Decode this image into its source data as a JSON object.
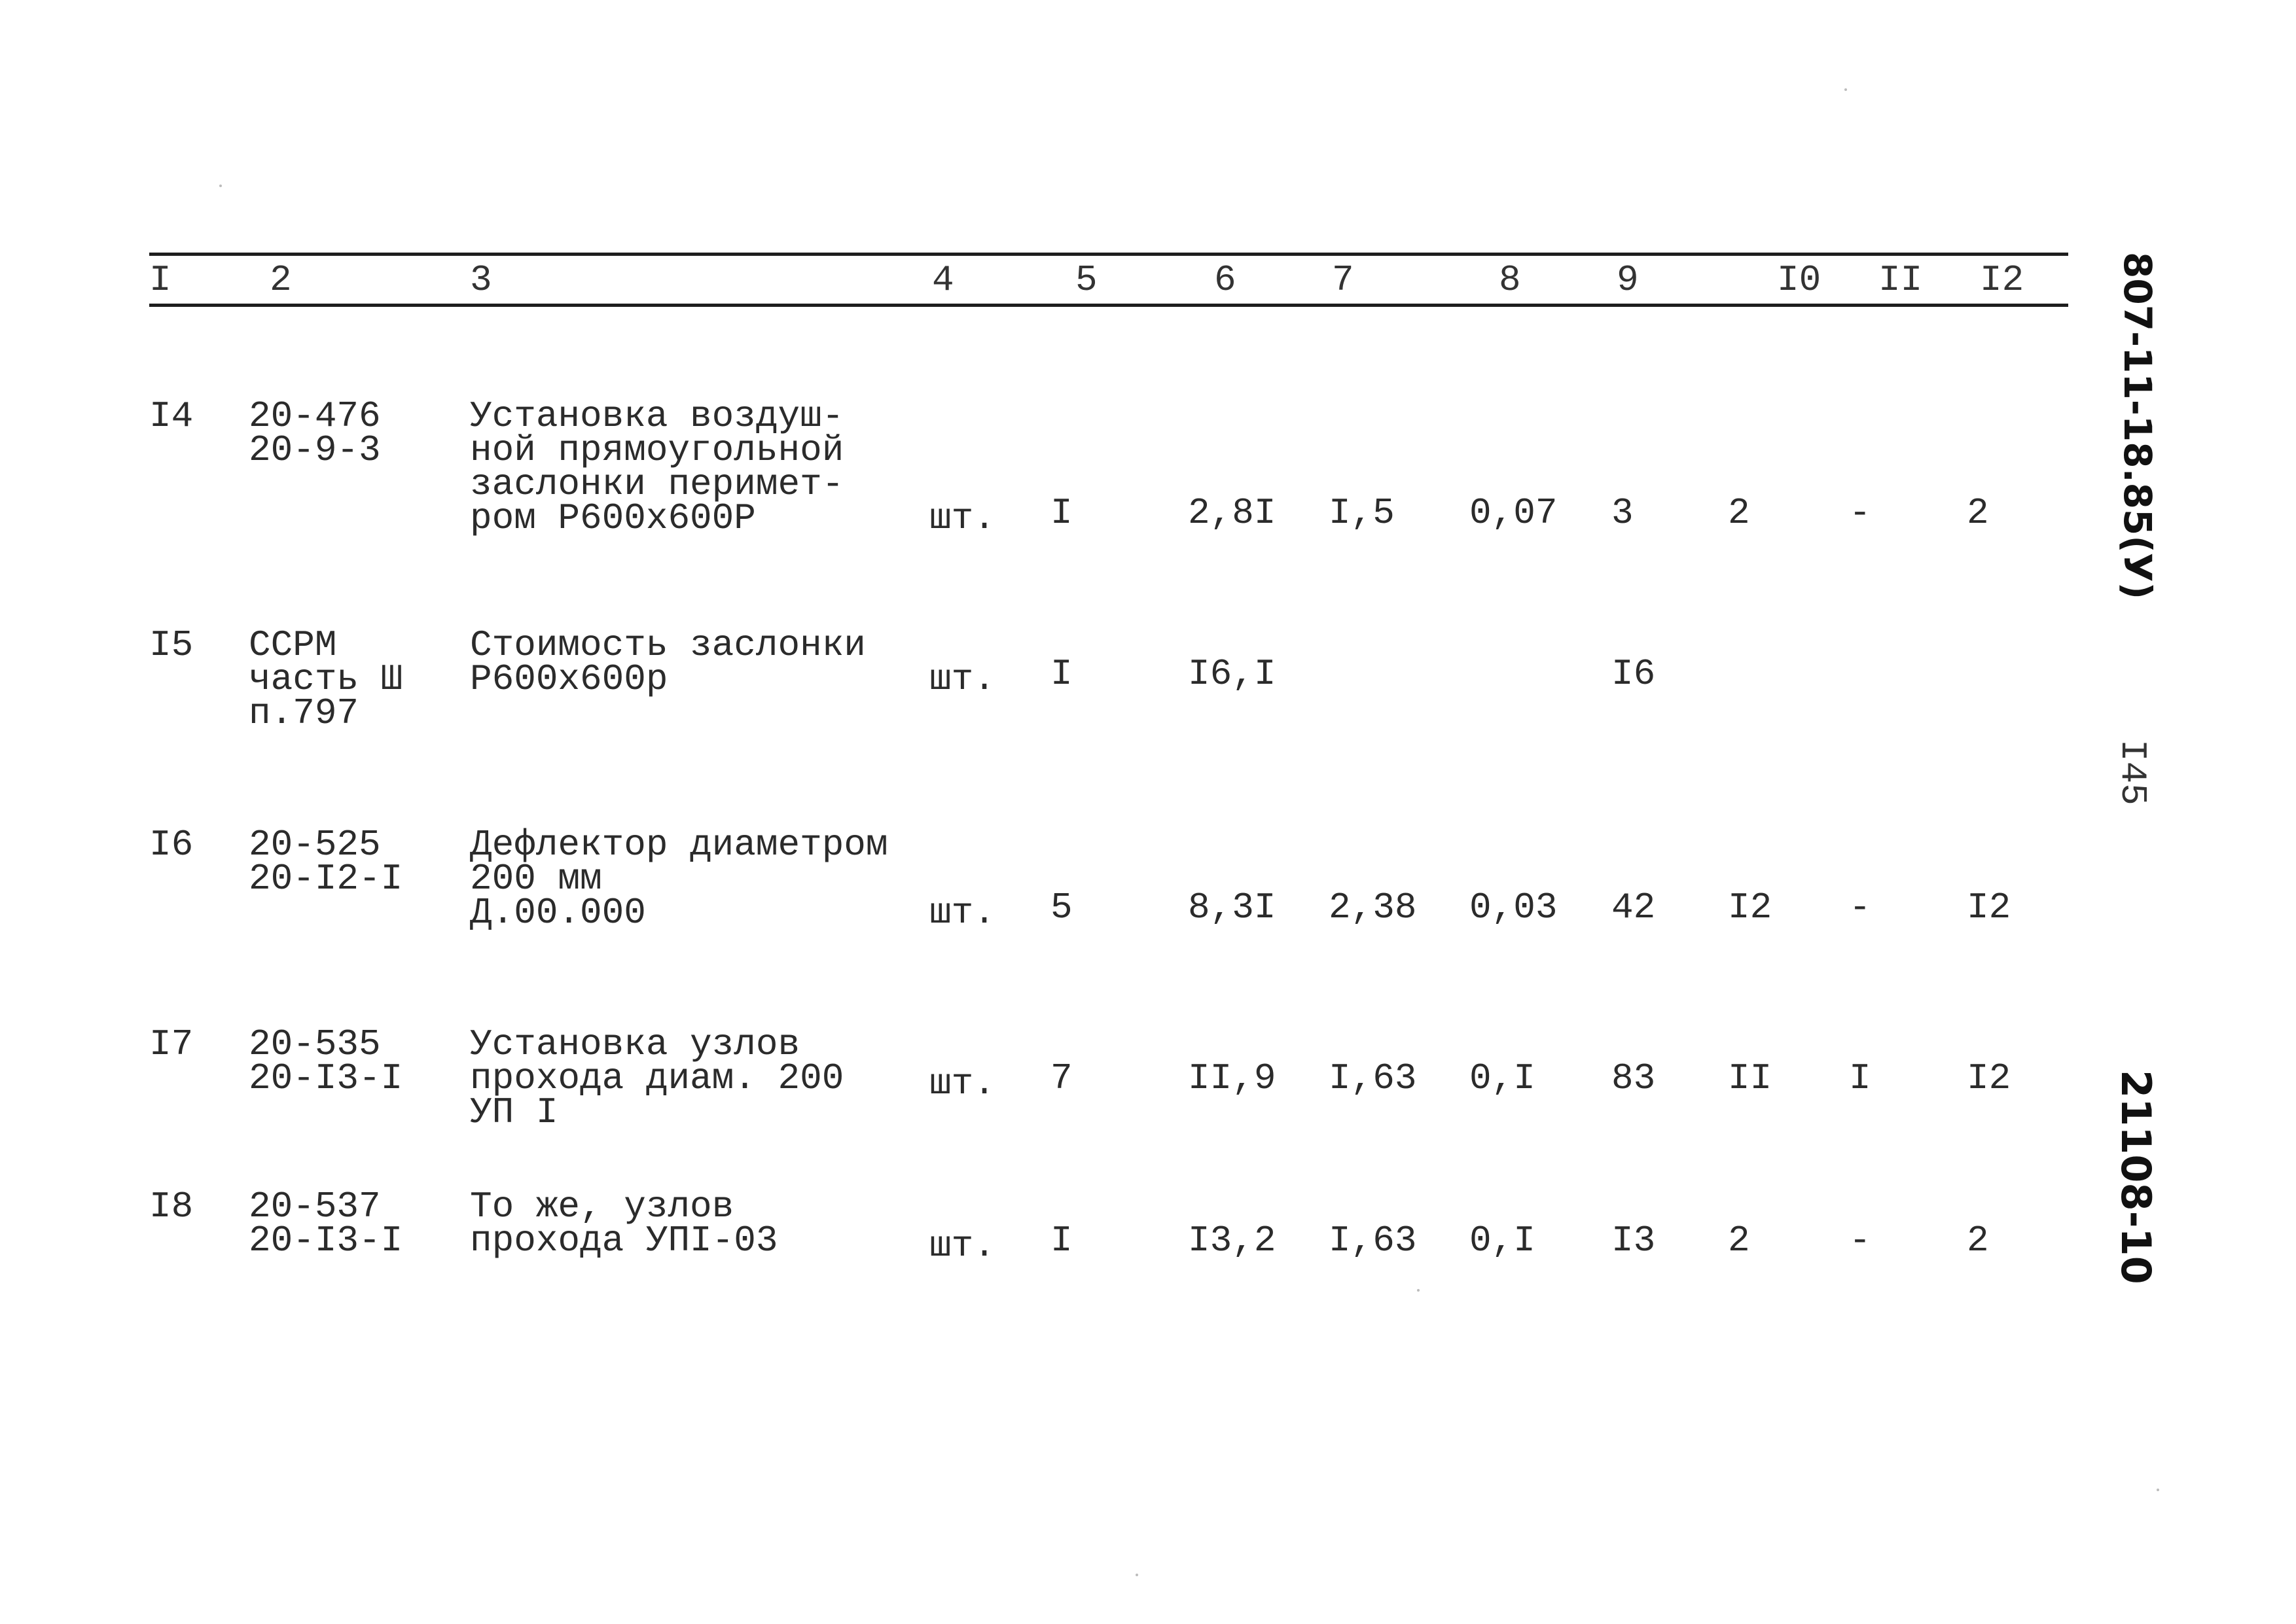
{
  "header": {
    "columns": [
      "I",
      "2",
      "3",
      "4",
      "5",
      "6",
      "7",
      "8",
      "9",
      "I0",
      "II",
      "I2"
    ]
  },
  "rows": [
    {
      "no": "I4",
      "code": [
        "20-476",
        "20-9-3"
      ],
      "desc": [
        "Установка воздуш-",
        "ной прямоугольной",
        "заслонки перимет-",
        "ром Р600х600Р"
      ],
      "unit": "шт.",
      "c5": "I",
      "c6": "2,8I",
      "c7": "I,5",
      "c8": "0,07",
      "c9": "3",
      "c10": "2",
      "c11": "-",
      "c12": "2"
    },
    {
      "no": "I5",
      "code": [
        "ССРМ",
        "часть Ш",
        "п.797"
      ],
      "desc": [
        "Стоимость заслонки",
        "Р600х600р"
      ],
      "unit": "шт.",
      "c5": "I",
      "c6": "I6,I",
      "c7": "",
      "c8": "",
      "c9": "I6",
      "c10": "",
      "c11": "",
      "c12": ""
    },
    {
      "no": "I6",
      "code": [
        "20-525",
        "20-I2-I"
      ],
      "desc": [
        "Дефлектор диаметром",
        "200 мм",
        "Д.00.000"
      ],
      "unit": "шт.",
      "c5": "5",
      "c6": "8,3I",
      "c7": "2,38",
      "c8": "0,03",
      "c9": "42",
      "c10": "I2",
      "c11": "-",
      "c12": "I2"
    },
    {
      "no": "I7",
      "code": [
        "20-535",
        "20-I3-I"
      ],
      "desc": [
        "Установка узлов",
        "прохода диам. 200",
        "УП I"
      ],
      "unit": "шт.",
      "c5": "7",
      "c6": "II,9",
      "c7": "I,63",
      "c8": "0,I",
      "c9": "83",
      "c10": "II",
      "c11": "I",
      "c12": "I2"
    },
    {
      "no": "I8",
      "code": [
        "20-537",
        "20-I3-I"
      ],
      "desc": [
        "То же, узлов",
        "прохода УПI-03"
      ],
      "unit": "шт.",
      "c5": "I",
      "c6": "I3,2",
      "c7": "I,63",
      "c8": "0,I",
      "c9": "I3",
      "c10": "2",
      "c11": "-",
      "c12": "2"
    }
  ],
  "margin": {
    "doc_code": "807-11-18.85(У)",
    "page_number": "I45",
    "archive_number": "21108-10"
  }
}
